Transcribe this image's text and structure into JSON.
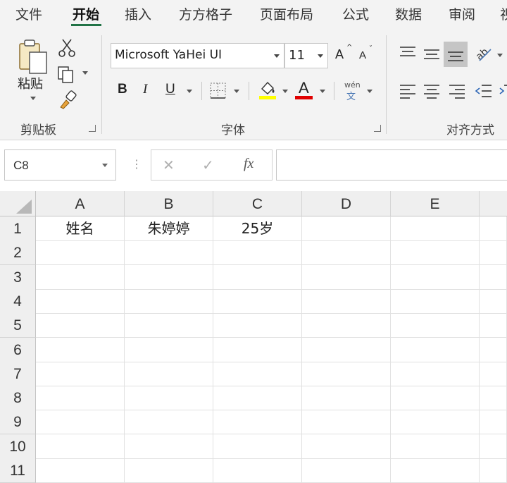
{
  "tabs": [
    "文件",
    "开始",
    "插入",
    "方方格子",
    "页面布局",
    "公式",
    "数据",
    "审阅",
    "视"
  ],
  "active_tab": "开始",
  "clipboard": {
    "paste_label": "粘贴",
    "group_label": "剪贴板"
  },
  "font": {
    "name": "Microsoft YaHei UI",
    "size": "11",
    "group_label": "字体",
    "bold": "B",
    "italic": "I",
    "underline": "U",
    "font_color_glyph": "A",
    "phonetic_top": "wén",
    "phonetic_bottom": "文",
    "grow": "A",
    "shrink": "A"
  },
  "alignment": {
    "group_label": "对齐方式"
  },
  "formula_bar": {
    "name_box": "C8",
    "cancel": "✕",
    "enter": "✓",
    "fx": "fx",
    "formula": ""
  },
  "colors": {
    "accent": "#217346",
    "fill_highlight": "#ffff00",
    "font_color": "#e00000"
  },
  "grid": {
    "columns": [
      "A",
      "B",
      "C",
      "D",
      "E"
    ],
    "rows": [
      "1",
      "2",
      "3",
      "4",
      "5",
      "6",
      "7",
      "8",
      "9",
      "10",
      "11"
    ],
    "cells": {
      "A1": "姓名",
      "B1": "朱婷婷",
      "C1": "25岁"
    }
  }
}
